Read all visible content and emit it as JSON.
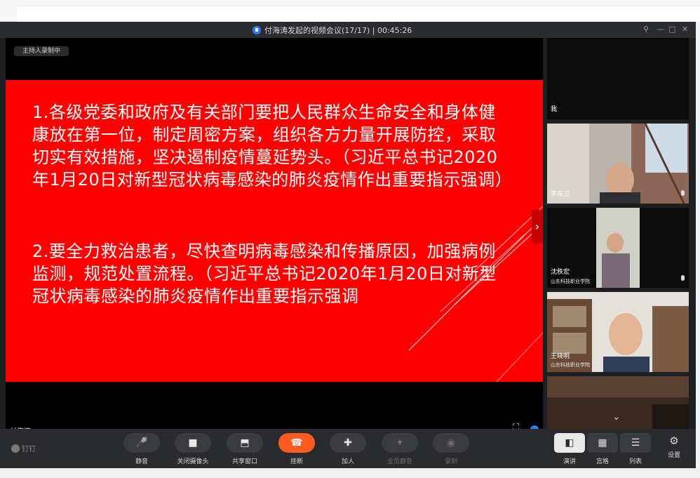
{
  "window": {
    "title": "付海涛发起的视频会议(17/17) | 00:45:26",
    "controls": [
      "pin",
      "minimize",
      "maximize",
      "close"
    ]
  },
  "stage": {
    "recording_badge": "主持人录制中",
    "presenter_name": "付海涛",
    "slide": {
      "bg_color": "#fe0000",
      "paragraphs": [
        "1.各级党委和政府及有关部门要把人民群众生命安全和身体健康放在第一位，制定周密方案，组织各方力量开展防控，采取切实有效措施，坚决遏制疫情蔓延势头。（习近平总书记2020年1月20日对新型冠状病毒感染的肺炎疫情作出重要指示强调）",
        "2.要全力救治患者，尽快查明病毒感染和传播原因，加强病例监测，规范处置流程。（习近平总书记2020年1月20日对新型冠状病毒感染的肺炎疫情作出重要指示强调"
      ]
    }
  },
  "participants": [
    {
      "name": "我",
      "org": ""
    },
    {
      "name": "李东卫",
      "org": ""
    },
    {
      "name": "沈秩宏",
      "org": "山东科技职业学院"
    },
    {
      "name": "王晓明",
      "org": "山东科技职业学院"
    },
    {
      "name": "",
      "org": ""
    }
  ],
  "controlbar": {
    "brand": "钉钉",
    "buttons": [
      {
        "label": "静音",
        "icon": "mic-icon",
        "glyph": "🎤"
      },
      {
        "label": "关闭摄像头",
        "icon": "camera-icon",
        "glyph": "■"
      },
      {
        "label": "共享窗口",
        "icon": "share-icon",
        "glyph": "⬒"
      },
      {
        "label": "挂断",
        "icon": "hangup-icon",
        "glyph": "☎"
      },
      {
        "label": "加人",
        "icon": "add-person-icon",
        "glyph": "✚"
      },
      {
        "label": "全员静音",
        "icon": "mute-all-icon",
        "glyph": "✦"
      },
      {
        "label": "录制",
        "icon": "record-icon",
        "glyph": "◉"
      }
    ],
    "views": [
      {
        "label": "演讲",
        "icon": "speaker-view-icon",
        "glyph": "◧"
      },
      {
        "label": "宫格",
        "icon": "grid-view-icon",
        "glyph": "▦"
      },
      {
        "label": "列表",
        "icon": "list-view-icon",
        "glyph": "☰"
      }
    ],
    "settings_label": "设置",
    "settings_glyph": "⚙"
  }
}
